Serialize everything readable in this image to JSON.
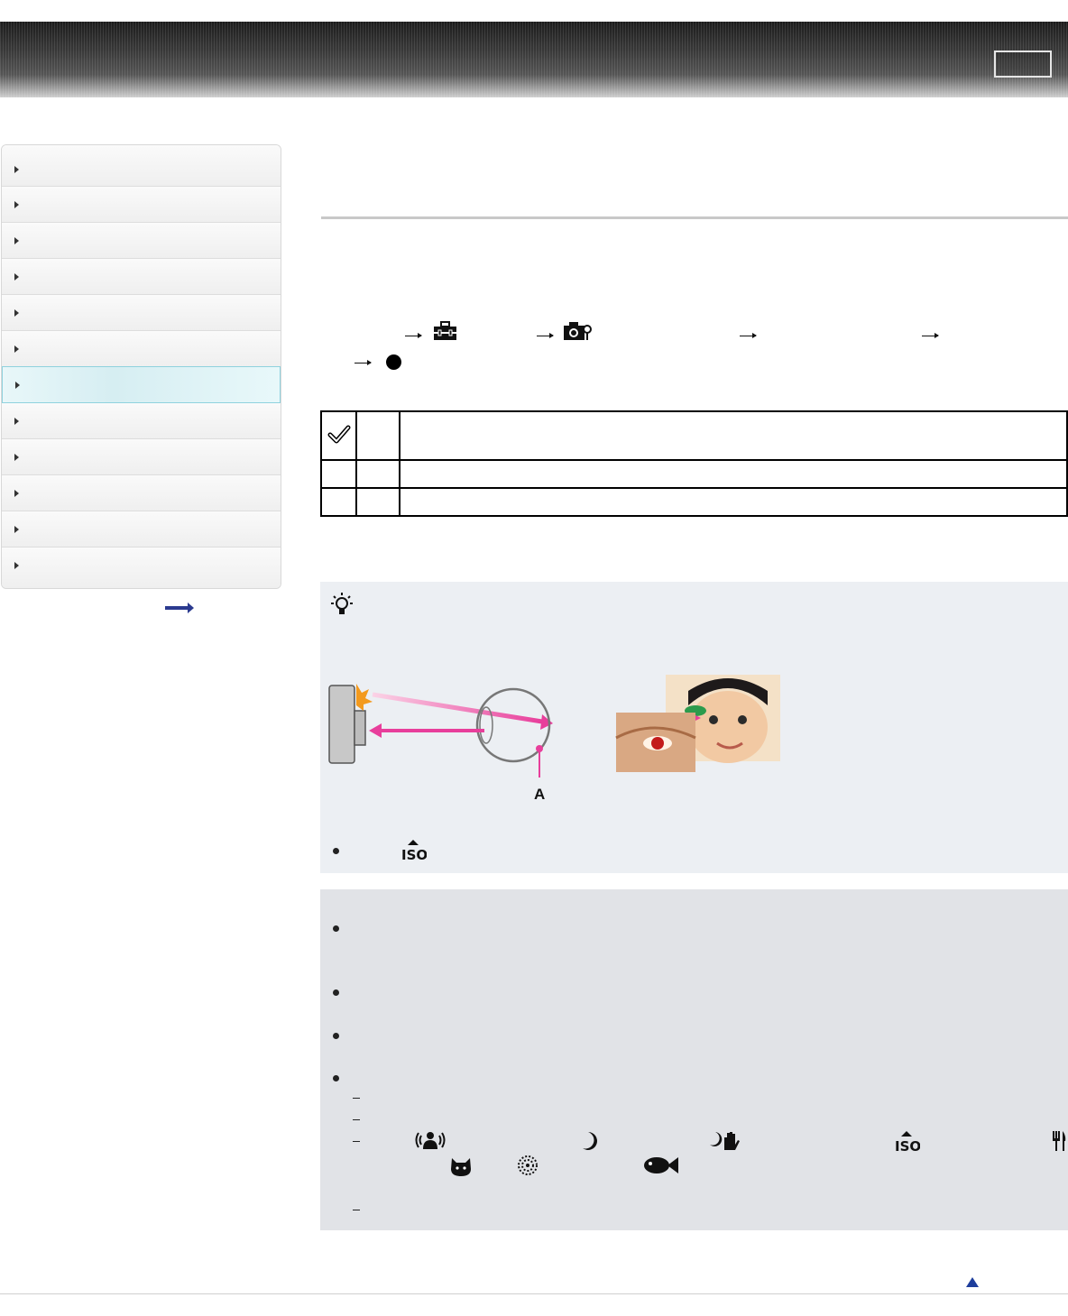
{
  "header": {
    "top_button_label": ""
  },
  "sidebar": {
    "items": [
      {
        "label": "",
        "active": false
      },
      {
        "label": "",
        "active": false
      },
      {
        "label": "",
        "active": false
      },
      {
        "label": "",
        "active": false
      },
      {
        "label": "",
        "active": false
      },
      {
        "label": "",
        "active": false
      },
      {
        "label": "",
        "active": true
      },
      {
        "label": "",
        "active": false
      },
      {
        "label": "",
        "active": false
      },
      {
        "label": "",
        "active": false
      },
      {
        "label": "",
        "active": false
      },
      {
        "label": "",
        "active": false
      }
    ],
    "more_link_icon": "right-arrow-icon"
  },
  "procedure": {
    "icons": [
      "toolbox-icon",
      "camera-settings-icon",
      "center-button-icon"
    ]
  },
  "options_table": {
    "rows": [
      {
        "icon": "checkmark-icon",
        "selected": true
      },
      {
        "icon": "",
        "selected": false
      },
      {
        "icon": "",
        "selected": false
      }
    ]
  },
  "hint": {
    "icon": "lightbulb-icon",
    "diagram_label": "A",
    "bullet_icon": "high-sensitivity-iso-icon"
  },
  "notes": {
    "scene_icons": [
      "anti-motion-blur-icon",
      "night-scene-icon",
      "handheld-twilight-icon",
      "high-sensitivity-iso-icon",
      "gourmet-icon",
      "pet-icon",
      "fireworks-icon",
      "underwater-fish-icon"
    ]
  },
  "colors": {
    "accent_arrow": "#e83e9b",
    "active_nav": "#d6eef2",
    "page_top": "#1e3e9c"
  }
}
